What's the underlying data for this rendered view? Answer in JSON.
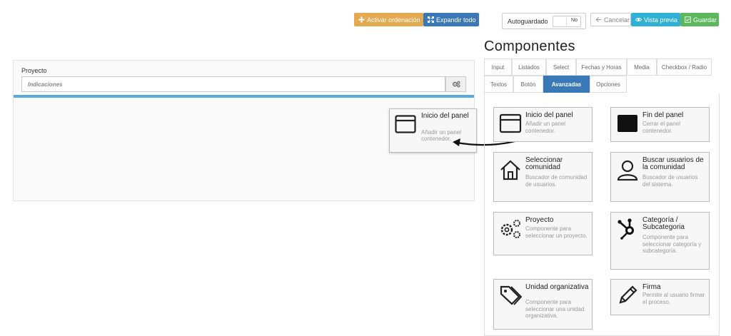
{
  "toolbar": {
    "order_label": "Activar ordenación",
    "expand_label": "Expandir todo",
    "autosave_label": "Autoguardado",
    "autosave_value": "No",
    "cancel_label": "Cancelar",
    "preview_label": "Vista previa",
    "save_label": "Guardar"
  },
  "canvas": {
    "project_label": "Proyecto",
    "project_placeholder": "Indicaciones"
  },
  "drag_card": {
    "title": "Inicio del panel",
    "description": "Añadir un panel contenedor."
  },
  "components": {
    "title": "Componentes",
    "tabs": [
      "Input",
      "Listados",
      "Select",
      "Fechas y Horas",
      "Media",
      "Checkbox / Radio",
      "Textos",
      "Botón",
      "Avanzadas",
      "Opciones"
    ],
    "active_tab": "Avanzadas",
    "cards": [
      {
        "title": "Inicio del panel",
        "description": "Añadir un panel contenedor.",
        "icon": "panel-outline-icon"
      },
      {
        "title": "Fin del panel",
        "description": "Cerrar el panel contenedor.",
        "icon": "panel-filled-icon"
      },
      {
        "title": "Seleccionar comunidad",
        "description": "Buscador de comunidad de usuarios.",
        "icon": "house-icon"
      },
      {
        "title": "Buscar usuarios de la comunidad",
        "description": "Buscador de usuarios del sistema.",
        "icon": "user-icon"
      },
      {
        "title": "Proyecto",
        "description": "Componente para seleccionar un proyecto.",
        "icon": "gears-icon"
      },
      {
        "title": "Categoría / Subcategoria",
        "description": "Componente para seleccionar categoría y subcategoría.",
        "icon": "hubspot-icon"
      },
      {
        "title": "Unidad organizativa",
        "description": "Componente para seleccionar una unidad organizativa.",
        "icon": "tags-icon"
      },
      {
        "title": "Firma",
        "description": "Permite al usuario firmar el proceso.",
        "icon": "pencil-icon"
      }
    ]
  },
  "colors": {
    "order_button": "#e4a951",
    "expand_button": "#3b78b8",
    "preview_button": "#31b0d5",
    "save_button": "#5cb85c",
    "active_tab": "#3b78b8",
    "drop_bar": "#5aaae0"
  }
}
